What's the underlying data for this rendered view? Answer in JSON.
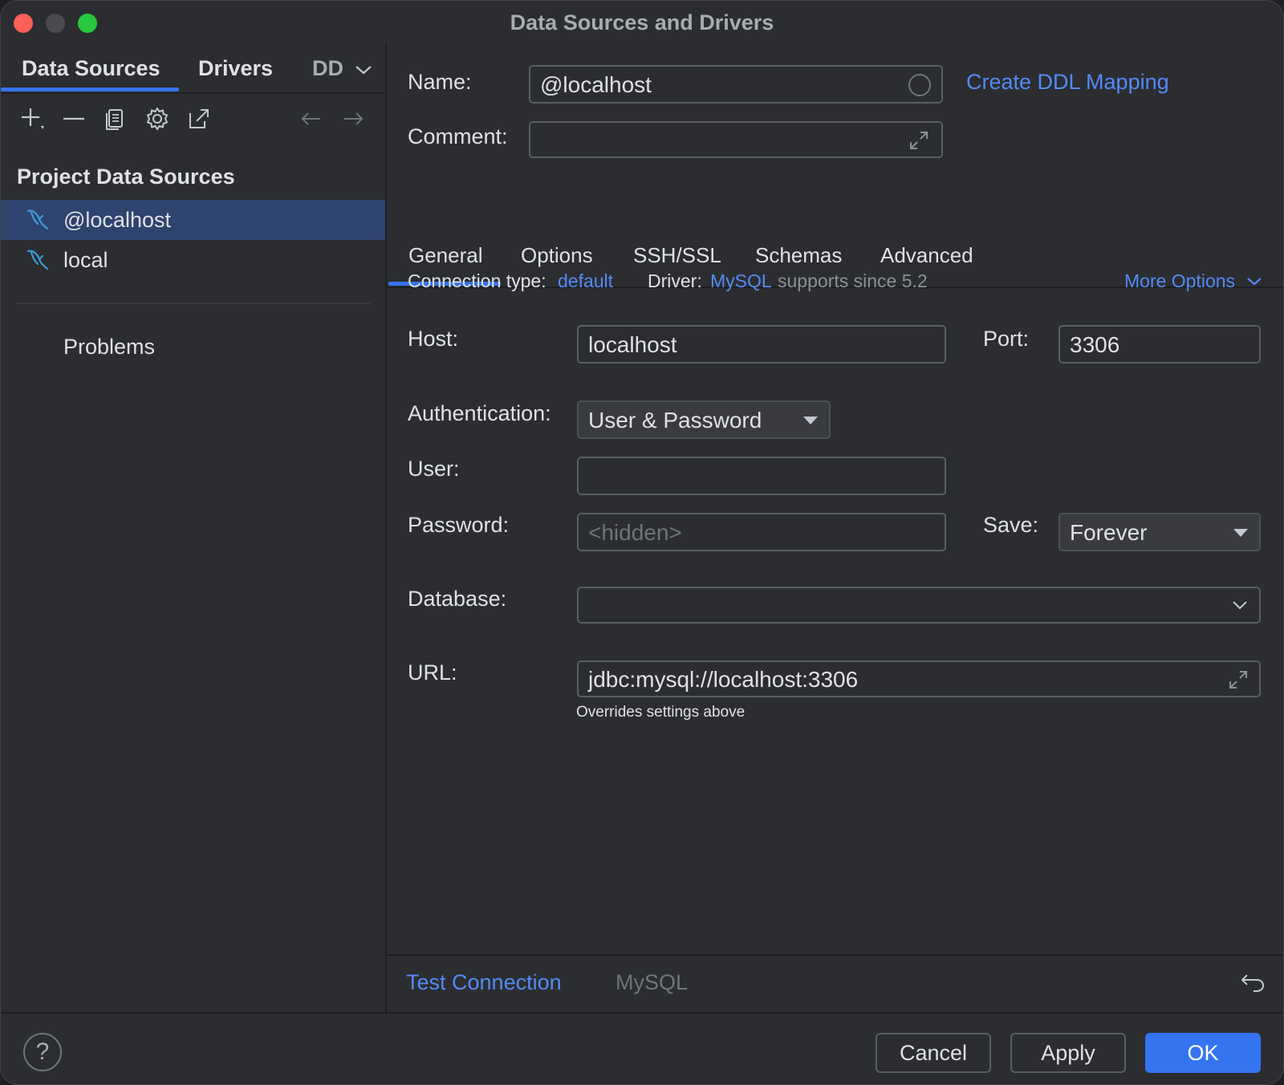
{
  "window": {
    "title": "Data Sources and Drivers"
  },
  "left": {
    "tabs": [
      {
        "label": "Data Sources"
      },
      {
        "label": "Drivers"
      },
      {
        "label": "DD"
      }
    ],
    "section_title": "Project Data Sources",
    "items": [
      {
        "label": "@localhost",
        "selected": true
      },
      {
        "label": "local",
        "selected": false
      }
    ],
    "problems": "Problems"
  },
  "form": {
    "name_label": "Name:",
    "name_value": "@localhost",
    "create_ddl": "Create DDL Mapping",
    "comment_label": "Comment:",
    "comment_value": ""
  },
  "tabs": [
    "General",
    "Options",
    "SSH/SSL",
    "Schemas",
    "Advanced"
  ],
  "general": {
    "connection_type_label": "Connection type:",
    "connection_type_value": "default",
    "driver_label": "Driver:",
    "driver_value": "MySQL",
    "driver_note": "supports since 5.2",
    "more_options": "More Options",
    "host_label": "Host:",
    "host_value": "localhost",
    "port_label": "Port:",
    "port_value": "3306",
    "auth_label": "Authentication:",
    "auth_value": "User & Password",
    "user_label": "User:",
    "user_value": "",
    "password_label": "Password:",
    "password_placeholder": "<hidden>",
    "save_label": "Save:",
    "save_value": "Forever",
    "database_label": "Database:",
    "database_value": "",
    "url_label": "URL:",
    "url_value": "jdbc:mysql://localhost:3306",
    "url_hint": "Overrides settings above"
  },
  "bottom": {
    "test_connection": "Test Connection",
    "driver_name": "MySQL"
  },
  "footer": {
    "help": "?",
    "cancel": "Cancel",
    "apply": "Apply",
    "ok": "OK"
  },
  "colors": {
    "accent": "#3574f0",
    "link": "#548af7",
    "background": "#2b2d30",
    "selection": "#2e436e",
    "mysql_icon": "#3b9bd8"
  }
}
